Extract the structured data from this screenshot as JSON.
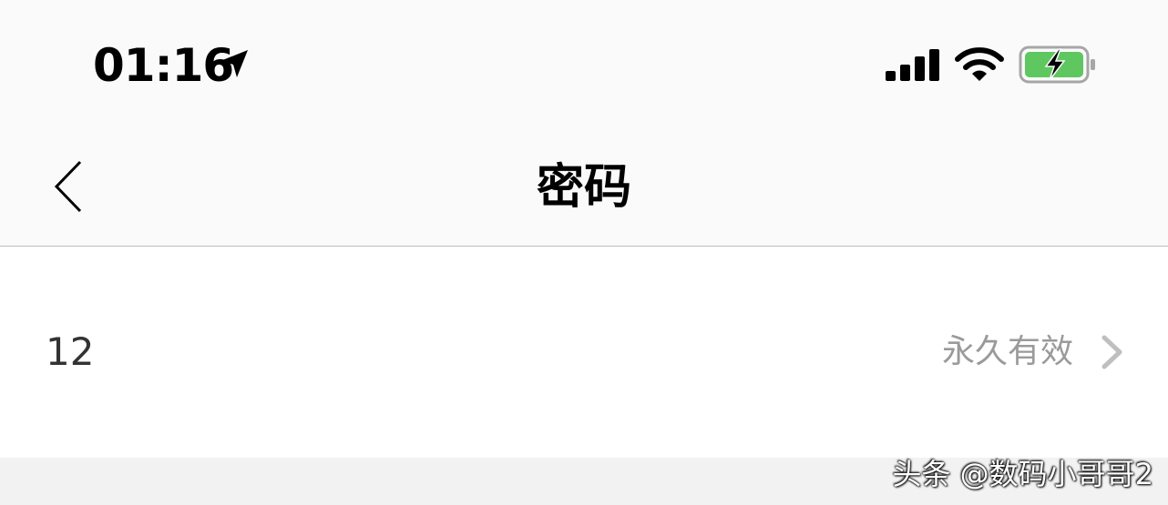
{
  "status_bar": {
    "time": "01:16",
    "icons": [
      "location-arrow-icon",
      "signal-bars-icon",
      "wifi-icon",
      "battery-charging-icon"
    ],
    "battery_color": "#5fc75f"
  },
  "nav": {
    "back_icon": "chevron-left-icon",
    "title": "密码"
  },
  "list": {
    "items": [
      {
        "name": "12",
        "status": "永久有效",
        "icon": "chevron-right-icon"
      }
    ]
  },
  "watermark": {
    "text": "头条 @数码小哥哥2"
  }
}
